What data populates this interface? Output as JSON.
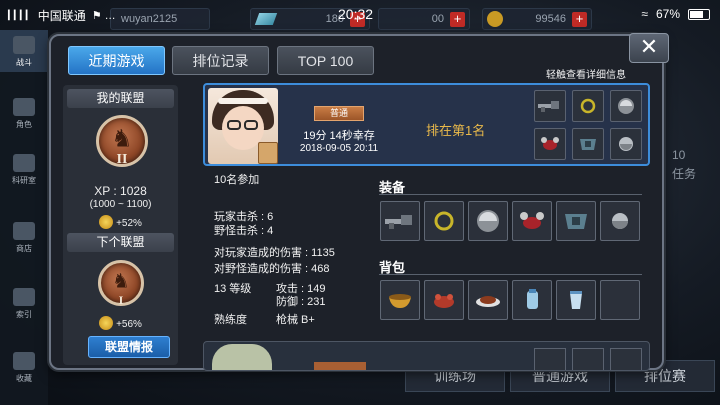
{
  "status_bar": {
    "signal": "▎▎▎▎",
    "carrier": "中国联通",
    "icons": "⚑ …",
    "time": "20:32",
    "battery": "67%"
  },
  "background": {
    "username": "wuyan2125",
    "stat1": "180",
    "stat2": "00",
    "coins": "99546",
    "bottom_buttons": [
      "训练场",
      "普通游戏",
      "排位赛"
    ],
    "side_text": "任务",
    "side_number": "10"
  },
  "left_nav": [
    {
      "label": "战斗",
      "active": true
    },
    {
      "label": "角色",
      "active": false
    },
    {
      "label": "科研室",
      "active": false
    },
    {
      "label": "商店",
      "active": false
    },
    {
      "label": "索引",
      "active": false
    },
    {
      "label": "收藏",
      "active": false
    }
  ],
  "dialog": {
    "tabs": [
      "近期游戏",
      "排位记录",
      "TOP 100"
    ],
    "active_tab": 0,
    "close_glyph": "✕",
    "hint": "轻触查看详细信息"
  },
  "alliance": {
    "my_title": "我的联盟",
    "my_rank": "II",
    "xp": "XP : 1028",
    "xp_range": "(1000 ~ 1100)",
    "my_bonus": "+52%",
    "next_title": "下个联盟",
    "next_rank": "I",
    "next_bonus": "+56%",
    "info_button": "联盟情报"
  },
  "game": {
    "mode": "普通",
    "survival": "19分 14秒幸存",
    "date": "2018-09-05 20:11",
    "placement": "排在第1名",
    "card_icons": [
      "rifle-icon",
      "ring-icon",
      "disc-icon",
      "crab-icon",
      "armor-icon",
      "ball-icon"
    ],
    "details": {
      "participants": "10名参加",
      "player_kills": "玩家击杀 : 6",
      "monster_kills": "野怪击杀 : 4",
      "player_damage": "对玩家造成的伤害 : 1135",
      "monster_damage": "对野怪造成的伤害 : 468",
      "level": "13 等级",
      "attack": "攻击 : 149",
      "defense": "防御 : 231",
      "proficiency_label": "熟练度",
      "proficiency_value": "枪械 B+"
    },
    "equipment_title": "装备",
    "equipment": [
      "rifle-icon",
      "ring-icon",
      "disc-icon",
      "crab-icon",
      "armor-icon",
      "ball-icon"
    ],
    "bag_title": "背包",
    "bag": [
      "bowl-icon",
      "crab-dish-icon",
      "steak-icon",
      "water-icon",
      "cup-icon",
      "empty"
    ]
  },
  "colors": {
    "accent_blue": "#2473c6",
    "placement_gold": "#e9b94a",
    "close_red": "#c02b26",
    "badge_bronze": "#8e4626"
  }
}
